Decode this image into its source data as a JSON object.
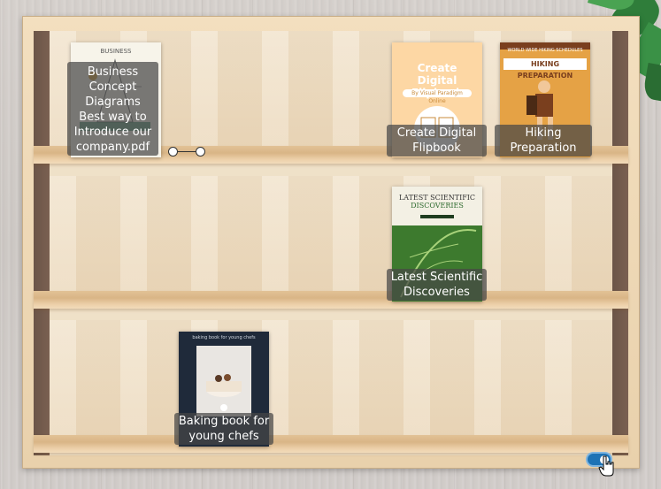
{
  "shelves": [
    {
      "books": [
        {
          "label": "Business Concept Diagrams Best way to Introduce our company.pdf",
          "cover": {
            "top_text": "BUSINESS",
            "accent": "#2e7d5b"
          }
        },
        {
          "label": "Create Digital Flipbook",
          "cover": {
            "title": "Create Digital Flipbook",
            "subtitle": "By Visual Paradigm Online",
            "bg": "#fdd7a4"
          }
        },
        {
          "label": "Hiking Preparation",
          "cover": {
            "eyebrow": "WORLD WIDE HIKING SCHEDULES",
            "title": "HIKING PREPARATION",
            "bg": "#e5a245"
          }
        }
      ]
    },
    {
      "books": [
        {
          "label": "Latest Scientific Discoveries",
          "cover": {
            "title": "LATEST SCIENTIFIC",
            "title2": "DISCOVERIES",
            "bg": "#f3f0e4",
            "accent": "#2f6b2f"
          }
        }
      ]
    },
    {
      "books": [
        {
          "label": "Baking book for young chefs",
          "cover": {
            "title": "baking book for young chefs",
            "bg": "#1f2a3a"
          }
        }
      ]
    }
  ],
  "toggle": {
    "state": "on",
    "color": "#1e73b5"
  }
}
